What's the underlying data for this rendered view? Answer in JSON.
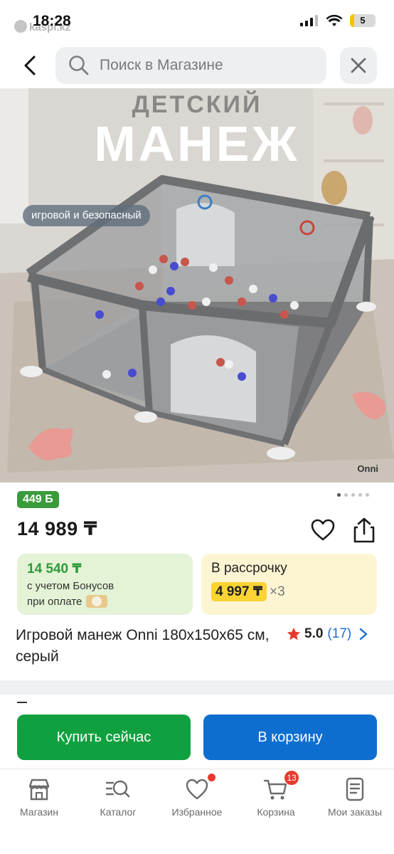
{
  "status_bar": {
    "time": "18:28",
    "watermark": "kaspi.kz",
    "battery": "5"
  },
  "search": {
    "placeholder": "Поиск в Магазине"
  },
  "product_image": {
    "title_small": "ДЕТСКИЙ",
    "title_big": "МАНЕЖ",
    "badge": "игровой и безопасный",
    "brand": "Onni",
    "pages": 5,
    "active_page": 1
  },
  "product": {
    "bonus_badge": "449 Б",
    "price": "14 989 ₸",
    "title": "Игровой манеж Onni 180x150x65 см, серый",
    "rating": "5.0",
    "reviews": "(17)"
  },
  "bonus_card": {
    "amount": "14 540 ₸",
    "line1": "с учетом Бонусов",
    "line2": "при оплате"
  },
  "installment_card": {
    "title": "В рассрочку",
    "price": "4 997 ₸",
    "multiplier": "×3"
  },
  "actions": {
    "buy_now": "Купить сейчас",
    "add_to_cart": "В корзину"
  },
  "bottom_nav": {
    "items": [
      {
        "label": "Магазин",
        "icon": "shop-icon"
      },
      {
        "label": "Каталог",
        "icon": "catalog-icon"
      },
      {
        "label": "Избранное",
        "icon": "heart-icon"
      },
      {
        "label": "Корзина",
        "icon": "cart-icon",
        "badge": "13"
      },
      {
        "label": "Мои заказы",
        "icon": "orders-icon"
      }
    ]
  },
  "colors": {
    "green": "#10a040",
    "blue": "#0e6ed0",
    "badge_red": "#e63b2e"
  }
}
